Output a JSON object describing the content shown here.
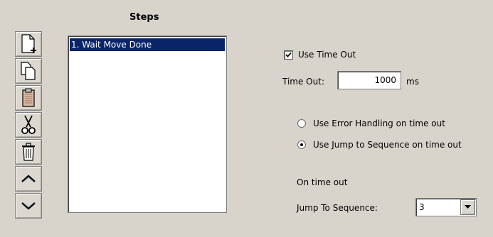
{
  "steps": {
    "title": "Steps",
    "items": [
      "1. Wait Move Done"
    ]
  },
  "toolbar": {
    "buttons": [
      "new-step-icon",
      "copy-icon",
      "paste-icon",
      "cut-icon",
      "delete-icon",
      "move-up-icon",
      "move-down-icon"
    ]
  },
  "timeout": {
    "use_timeout_label": "Use Time Out",
    "use_timeout_checked": true,
    "label": "Time Out:",
    "value": "1000",
    "unit": "ms"
  },
  "handling": {
    "error_label": "Use Error Handling on time out",
    "jump_label": "Use Jump to Sequence on time out",
    "selected": "jump"
  },
  "on_timeout": {
    "heading": "On time out",
    "jump_label": "Jump To Sequence:",
    "jump_value": "3"
  }
}
